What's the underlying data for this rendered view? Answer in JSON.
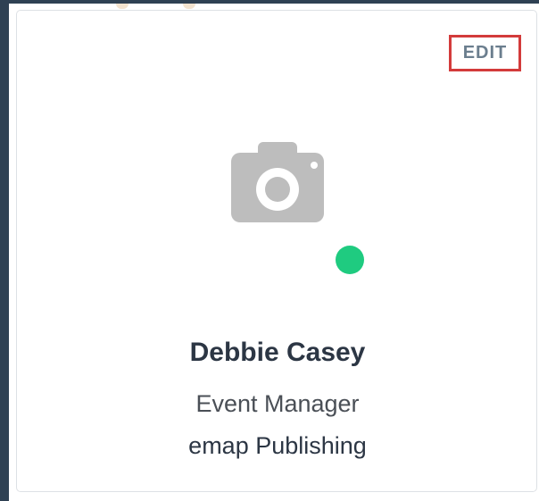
{
  "card": {
    "edit_label": "EDIT",
    "name": "Debbie Casey",
    "job_title": "Event Manager",
    "company": "emap Publishing",
    "status": "online"
  },
  "colors": {
    "frame": "#2f4153",
    "edit_text": "#6b7e8e",
    "edit_highlight": "#d33b3b",
    "status_online": "#1fcb80",
    "placeholder_icon": "#bdbdbd"
  },
  "icons": {
    "photo_placeholder": "camera-icon"
  }
}
